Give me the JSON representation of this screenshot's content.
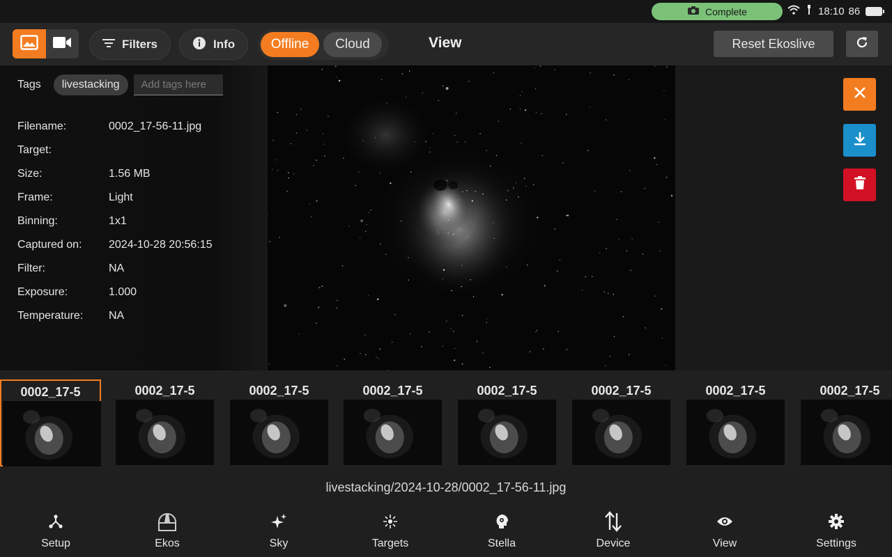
{
  "status_bar": {
    "capture_status": "Complete",
    "time": "18:10",
    "battery": "86"
  },
  "toolbar": {
    "modes": [
      {
        "name": "image-mode",
        "icon": "image-icon",
        "active": true
      },
      {
        "name": "video-mode",
        "icon": "video-icon",
        "active": false
      }
    ],
    "filters_label": "Filters",
    "info_label": "Info",
    "storage_options": [
      "Offline",
      "Cloud"
    ],
    "storage_selected": "Offline",
    "title": "View",
    "reset_label": "Reset Ekoslive",
    "accent_color": "#f47c20"
  },
  "tags": {
    "label": "Tags",
    "items": [
      "livestacking"
    ],
    "placeholder": "Add tags here"
  },
  "metadata": [
    {
      "key": "Filename:",
      "value": "0002_17-56-11.jpg"
    },
    {
      "key": "Target:",
      "value": ""
    },
    {
      "key": "Size:",
      "value": "1.56 MB"
    },
    {
      "key": "Frame:",
      "value": "Light"
    },
    {
      "key": "Binning:",
      "value": "1x1"
    },
    {
      "key": "Captured on:",
      "value": "2024-10-28 20:56:15"
    },
    {
      "key": "Filter:",
      "value": "NA"
    },
    {
      "key": "Exposure:",
      "value": "1.000"
    },
    {
      "key": "Temperature:",
      "value": "NA"
    }
  ],
  "side_actions": [
    {
      "name": "close-button",
      "icon": "close-icon",
      "color": "#f47c20"
    },
    {
      "name": "download-button",
      "icon": "download-icon",
      "color": "#1b8fc9"
    },
    {
      "name": "delete-button",
      "icon": "trash-icon",
      "color": "#d21124"
    }
  ],
  "thumbnails": [
    {
      "label": "0002_17-5",
      "selected": true
    },
    {
      "label": "0002_17-5",
      "selected": false
    },
    {
      "label": "0002_17-5",
      "selected": false
    },
    {
      "label": "0002_17-5",
      "selected": false
    },
    {
      "label": "0002_17-5",
      "selected": false
    },
    {
      "label": "0002_17-5",
      "selected": false
    },
    {
      "label": "0002_17-5",
      "selected": false
    },
    {
      "label": "0002_17-5",
      "selected": false
    }
  ],
  "file_path": "livestacking/2024-10-28/0002_17-56-11.jpg",
  "nav": [
    {
      "label": "Setup",
      "icon": "setup-icon"
    },
    {
      "label": "Ekos",
      "icon": "observatory-icon"
    },
    {
      "label": "Sky",
      "icon": "sparkle-icon"
    },
    {
      "label": "Targets",
      "icon": "target-icon"
    },
    {
      "label": "Stella",
      "icon": "assistant-icon"
    },
    {
      "label": "Device",
      "icon": "transfer-arrows-icon"
    },
    {
      "label": "View",
      "icon": "eye-icon"
    },
    {
      "label": "Settings",
      "icon": "gear-icon"
    }
  ]
}
